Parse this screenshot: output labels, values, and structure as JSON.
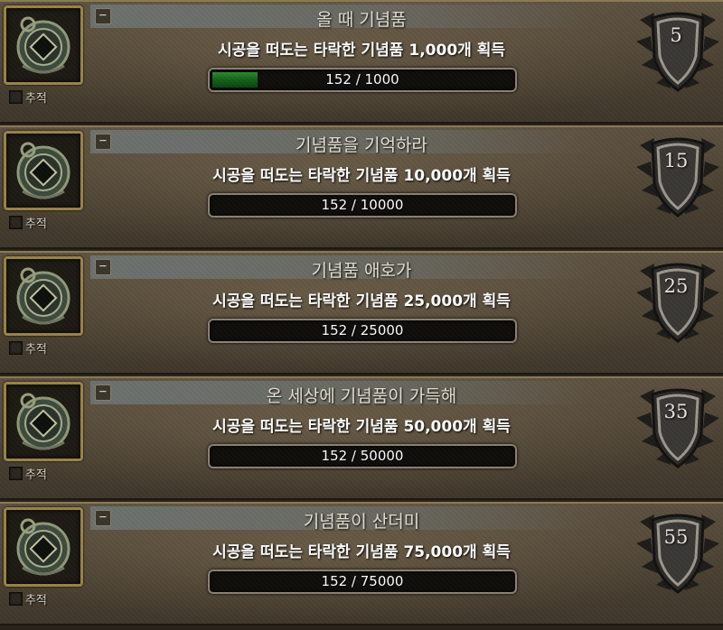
{
  "track_label": "추적",
  "collapse_symbol": "−",
  "achievements": [
    {
      "title": "올 때 기념품",
      "description": "시공을 떠도는 타락한 기념품 1,000개 획득",
      "progress_text": "152 / 1000",
      "progress_fraction": 0.152,
      "points": "5"
    },
    {
      "title": "기념품을 기억하라",
      "description": "시공을 떠도는 타락한 기념품 10,000개 획득",
      "progress_text": "152 / 10000",
      "progress_fraction": 0.0152,
      "points": "15"
    },
    {
      "title": "기념품 애호가",
      "description": "시공을 떠도는 타락한 기념품 25,000개 획득",
      "progress_text": "152 / 25000",
      "progress_fraction": 0.00608,
      "points": "25"
    },
    {
      "title": "온 세상에 기념품이 가득해",
      "description": "시공을 떠도는 타락한 기념품 50,000개 획득",
      "progress_text": "152 / 50000",
      "progress_fraction": 0.00304,
      "points": "35"
    },
    {
      "title": "기념품이 산더미",
      "description": "시공을 떠도는 타락한 기념품 75,000개 획득",
      "progress_text": "152 / 75000",
      "progress_fraction": 0.002027,
      "points": "55"
    }
  ],
  "icon_name": "souvenir-trinket-icon",
  "shield_icon_name": "achievement-points-shield-icon",
  "colors": {
    "progress_fill": "#1f7a22",
    "frame_gold": "#9a8347"
  }
}
